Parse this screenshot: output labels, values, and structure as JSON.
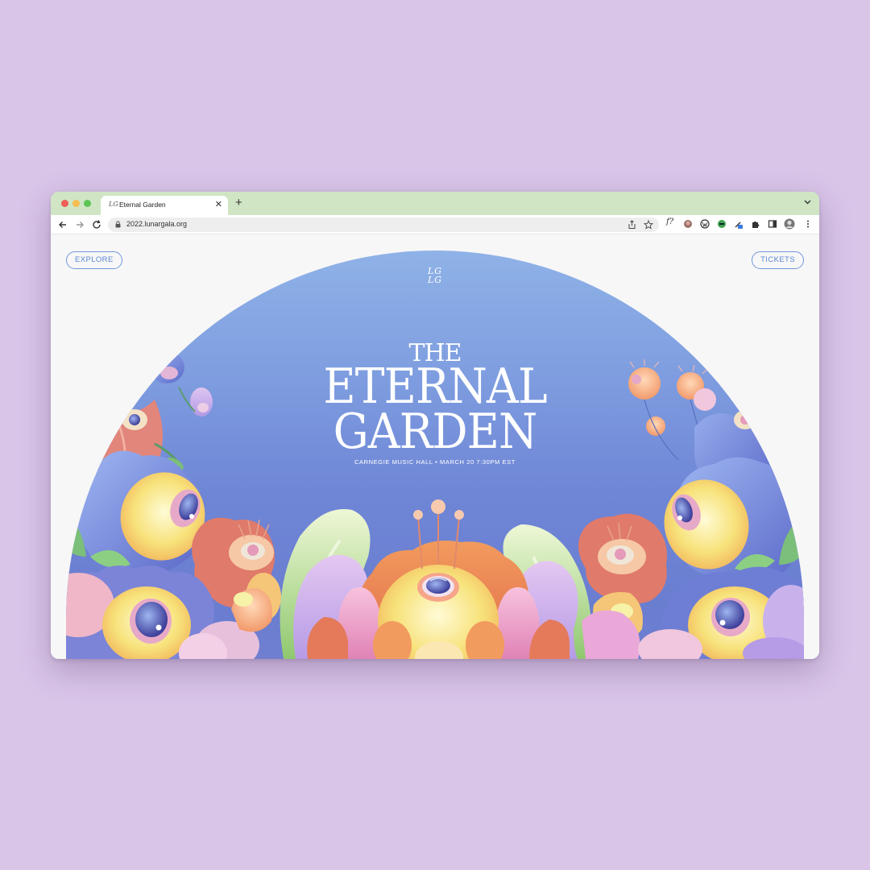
{
  "browser": {
    "tab": {
      "title": "Eternal Garden",
      "favicon_text": "LG"
    },
    "url": "2022.lunargala.org",
    "icons": [
      "back-arrow-icon",
      "forward-arrow-icon",
      "reload-icon",
      "lock-icon",
      "share-icon",
      "star-icon",
      "extensions-icon",
      "sidebar-icon",
      "profile-avatar-icon",
      "more-menu-icon"
    ]
  },
  "page": {
    "nav": {
      "left": "EXPLORE",
      "right": "TICKETS"
    },
    "logo": {
      "line1": "LG",
      "line2": "LG"
    },
    "hero": {
      "title_small": "THE",
      "title_line1": "ETERNAL",
      "title_line2": "GARDEN",
      "subtitle": "CARNEGIE MUSIC HALL • MARCH 20 7:30PM EST"
    }
  },
  "colors": {
    "backdrop": "#d9c5e8",
    "tabstrip": "#cfe5c3",
    "accent": "#5b86d4",
    "sky_top": "#8fb2e7",
    "sky_bottom": "#6a7dd0"
  }
}
